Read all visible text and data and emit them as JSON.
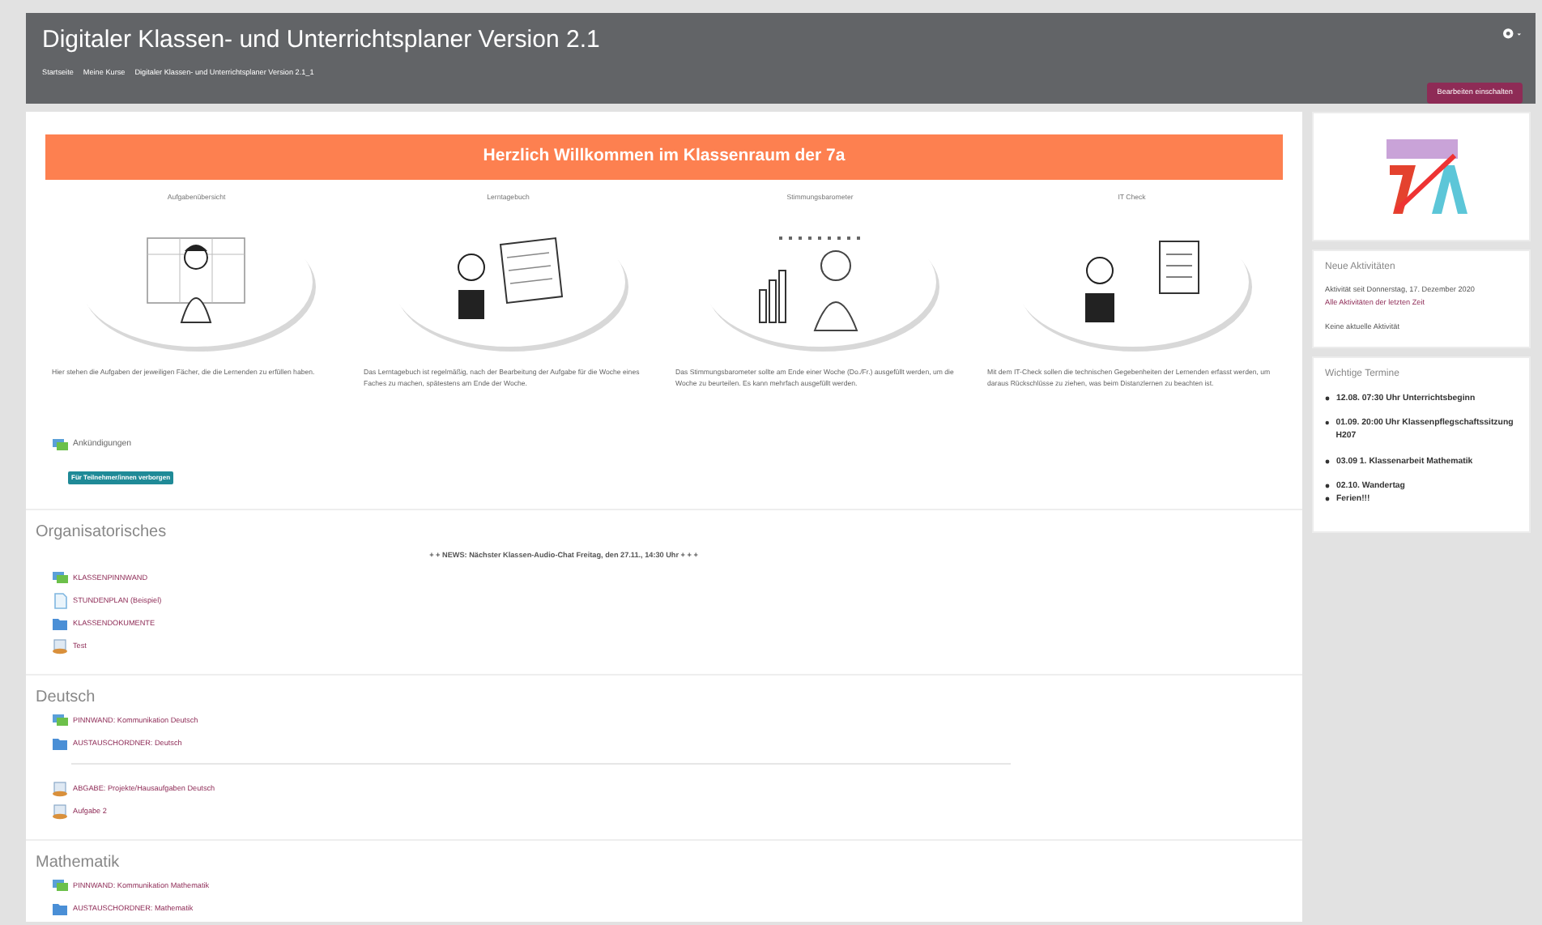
{
  "header": {
    "title": "Digitaler Klassen- und Unterrichtsplaner Version 2.1",
    "breadcrumbs": [
      "Startseite",
      "Meine Kurse",
      "Digitaler Klassen- und Unterrichtsplaner Version 2.1_1"
    ],
    "edit_button": "Bearbeiten einschalten"
  },
  "welcome_banner": "Herzlich Willkommen im Klassenraum der 7a",
  "tiles": [
    {
      "title": "Aufgabenübersicht",
      "description": "Hier stehen die Aufgaben der jeweiligen Fächer, die die Lernenden zu erfüllen haben."
    },
    {
      "title": "Lerntagebuch",
      "description": "Das Lerntagebuch ist regelmäßig, nach der Bearbeitung der Aufgabe für die Woche eines Faches zu machen, spätestens am Ende der Woche."
    },
    {
      "title": "Stimmungsbarometer",
      "description": "Das Stimmungsbarometer sollte am Ende einer Woche (Do./Fr.) ausgefüllt werden, um die Woche zu beurteilen. Es kann mehrfach ausgefüllt werden."
    },
    {
      "title": "IT Check",
      "description": "Mit dem IT-Check sollen die technischen Gegebenheiten der Lernenden erfasst werden, um daraus Rückschlüsse zu ziehen, was beim Distanzlernen zu beachten ist."
    }
  ],
  "announcements": {
    "label": "Ankündigungen",
    "badge": "Für Teilnehmer/innen verborgen"
  },
  "sections": [
    {
      "title": "Organisatorisches",
      "news": "+ + NEWS: Nächster Klassen-Audio-Chat Freitag, den 27.11., 14:30 Uhr + + +",
      "groups": [
        {
          "items": [
            {
              "kind": "forum",
              "label": "KLASSENPINNWAND"
            },
            {
              "kind": "page",
              "label": "STUNDENPLAN (Beispiel)"
            },
            {
              "kind": "folder",
              "label": "KLASSENDOKUMENTE"
            },
            {
              "kind": "assign",
              "label": "Test"
            }
          ]
        }
      ]
    },
    {
      "title": "Deutsch",
      "groups": [
        {
          "items": [
            {
              "kind": "forum",
              "label": "PINNWAND: Kommunikation Deutsch"
            },
            {
              "kind": "folder",
              "label": "AUSTAUSCHORDNER: Deutsch"
            }
          ]
        },
        {
          "items": [
            {
              "kind": "assign",
              "label": "ABGABE: Projekte/Hausaufgaben Deutsch"
            },
            {
              "kind": "assign",
              "label": "Aufgabe 2"
            }
          ]
        }
      ]
    },
    {
      "title": "Mathematik",
      "groups": [
        {
          "items": [
            {
              "kind": "forum",
              "label": "PINNWAND: Kommunikation Mathematik"
            },
            {
              "kind": "folder",
              "label": "AUSTAUSCHORDNER: Mathematik"
            }
          ]
        }
      ]
    }
  ],
  "sidebar": {
    "activity": {
      "title": "Neue Aktivitäten",
      "since": "Aktivität seit Donnerstag, 17. Dezember 2020",
      "link": "Alle Aktivitäten der letzten Zeit",
      "empty": "Keine aktuelle Aktivität"
    },
    "dates": {
      "title": "Wichtige Termine",
      "items": [
        "12.08. 07:30 Uhr Unterrichtsbeginn",
        "01.09. 20:00 Uhr Klassenpflegschaftssitzung H207",
        "03.09 1. Klassenarbeit Mathematik",
        "02.10. Wandertag",
        "Ferien!!!"
      ]
    }
  }
}
